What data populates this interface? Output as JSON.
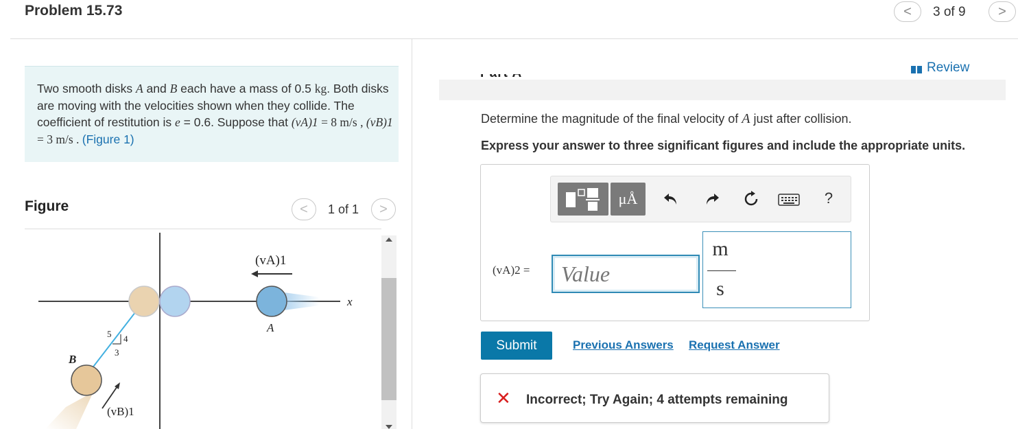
{
  "header": {
    "title": "Problem 15.73",
    "nav_count": "3 of 9",
    "prev_glyph": "<",
    "next_glyph": ">"
  },
  "statement": {
    "p1": "Two smooth disks ",
    "A": "A",
    "p2": " and ",
    "B": "B",
    "p3": " each have a mass of 0.5 ",
    "kg": "kg",
    "p4": ". Both disks are moving with the velocities shown when they collide. The coefficient of restitution is ",
    "e_sym": "e",
    "p5": " = 0.6. Suppose that ",
    "vA1": "(vA)1",
    "p6": " = 8  m/s , ",
    "vB1": "(vB)1",
    "p7": " = 3  m/s . ",
    "figure_link": "(Figure 1)"
  },
  "figure": {
    "label": "Figure",
    "count": "1 of 1",
    "labels": {
      "vA1": "(vA)1",
      "x": "x",
      "A": "A",
      "B": "B",
      "vB1": "(vB)1",
      "five": "5",
      "four": "4",
      "three": "3"
    }
  },
  "part": {
    "review": "Review",
    "question": "Determine the magnitude of the final velocity of ",
    "question_var": "A",
    "question_end": " just after collision.",
    "instruction": "Express your answer to three significant figures and include the appropriate units."
  },
  "answer": {
    "toolbar": {
      "units_label": "μÅ",
      "help": "?"
    },
    "var_label": "(vA)2 =",
    "placeholder": "Value",
    "unit_num": "m",
    "unit_den": "s",
    "submit": "Submit",
    "previous_answers": "Previous Answers",
    "request_answer": "Request Answer"
  },
  "feedback": {
    "icon": "✕",
    "text": "Incorrect; Try Again; 4 attempts remaining"
  },
  "colors": {
    "accent": "#0a78a8",
    "link": "#1a71b0",
    "statement_bg": "#e9f5f6",
    "error": "#d81e1e",
    "disk_A": "#7cb4dc",
    "disk_B": "#e6c79a"
  }
}
